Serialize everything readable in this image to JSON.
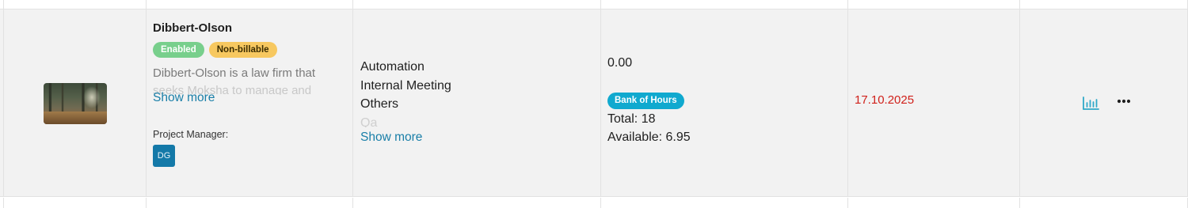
{
  "project": {
    "name": "Dibbert-Olson",
    "badges": {
      "status": "Enabled",
      "billing": "Non-billable"
    },
    "description_visible": "Dibbert-Olson is a law firm that",
    "description_partial": "seeks Moksha to manage and",
    "show_more": "Show more",
    "pm_label": "Project Manager:",
    "pm_initials": "DG"
  },
  "tasks": {
    "items": [
      "Automation",
      "Internal Meeting",
      "Others"
    ],
    "faded_item": "Qa",
    "show_more": "Show more"
  },
  "hours": {
    "value": "0.00",
    "badge": "Bank of Hours",
    "total": "Total: 18",
    "available": "Available: 6.95"
  },
  "date": "17.10.2025",
  "colors": {
    "row_bg": "#f2f2f2",
    "enabled_badge": "#78cf8c",
    "nonbillable_badge": "#f7c860",
    "link": "#1a7fa8",
    "bank_badge": "#10a9cf",
    "date_text": "#d0211b",
    "avatar_bg": "#1479a8",
    "chart_icon": "#2fa8c8"
  },
  "icons": {
    "chart": "bar-chart-icon",
    "more": "more-horizontal-icon"
  }
}
